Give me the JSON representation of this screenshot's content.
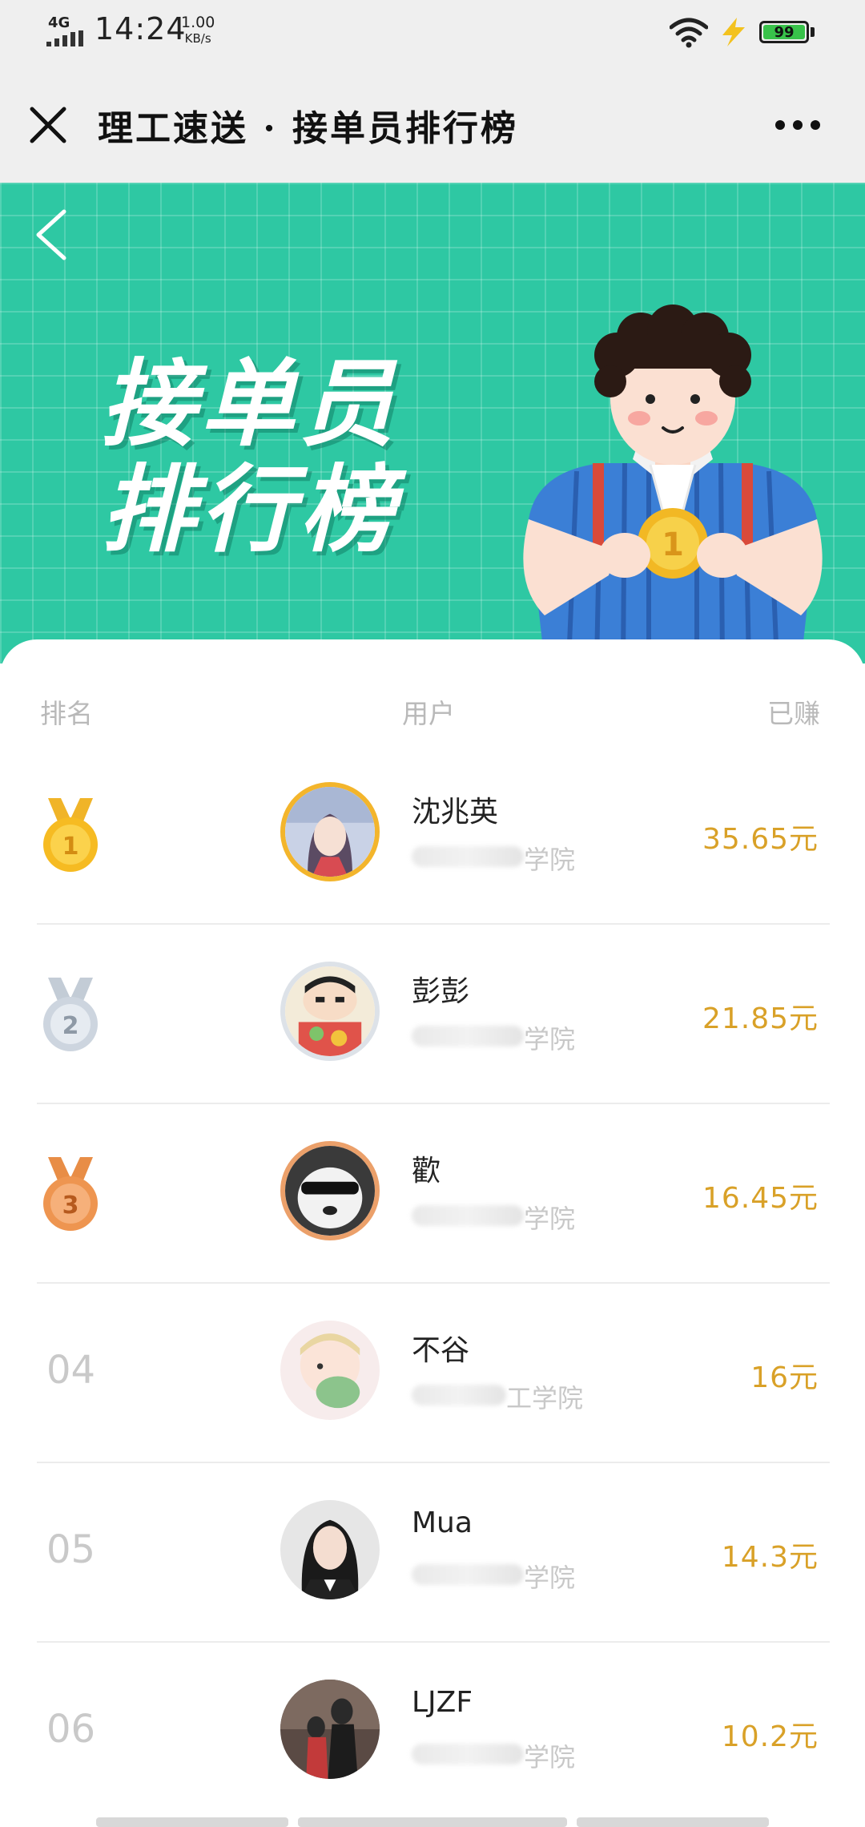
{
  "status": {
    "network": "4G",
    "time": "14:24",
    "speed_value": "1.00",
    "speed_unit": "KB/s",
    "battery": "99",
    "battery_color": "#38c24a"
  },
  "nav": {
    "title": "理工速送 · 接单员排行榜"
  },
  "banner": {
    "title_line1": "接单员",
    "title_line2": "排行榜",
    "bg_color": "#2ec8a3",
    "medal_text": "1"
  },
  "leaderboard": {
    "headers": {
      "rank": "排名",
      "user": "用户",
      "earned": "已赚"
    },
    "accent_color": "#d9a128",
    "rows": [
      {
        "rank": "1",
        "medal": "gold",
        "name": "沈兆英",
        "college": "学院",
        "earned": "35.65元"
      },
      {
        "rank": "2",
        "medal": "silver",
        "name": "彭彭",
        "college": "学院",
        "earned": "21.85元"
      },
      {
        "rank": "3",
        "medal": "bronze",
        "name": "歡",
        "college": "学院",
        "earned": "16.45元"
      },
      {
        "rank": "04",
        "medal": "",
        "name": "不谷",
        "college": "工学院",
        "earned": "16元"
      },
      {
        "rank": "05",
        "medal": "",
        "name": "Mua",
        "college": "学院",
        "earned": "14.3元"
      },
      {
        "rank": "06",
        "medal": "",
        "name": "LJZF",
        "college": "学院",
        "earned": "10.2元"
      }
    ]
  }
}
